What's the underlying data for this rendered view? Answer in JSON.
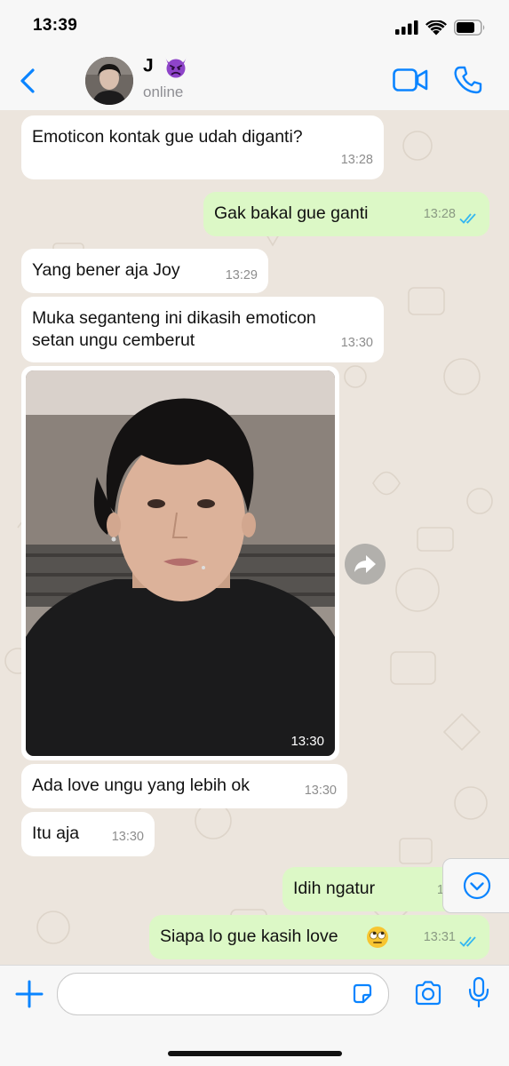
{
  "status_bar": {
    "time": "13:39"
  },
  "header": {
    "contact_name": "J",
    "contact_status": "online",
    "contact_emoji": "purple-devil-emoji",
    "icons": [
      "back-chevron-icon",
      "video-call-icon",
      "phone-call-icon"
    ]
  },
  "messages": [
    {
      "dir": "in",
      "text": "Emoticon kontak gue udah diganti?",
      "time": "13:28"
    },
    {
      "dir": "out",
      "text": "Gak bakal gue ganti",
      "time": "13:28",
      "read": true
    },
    {
      "dir": "in",
      "text": "Yang bener aja Joy",
      "time": "13:29"
    },
    {
      "dir": "in",
      "lines": [
        "Muka seganteng ini dikasih emoticon",
        "setan ungu cemberut"
      ],
      "time": "13:30"
    },
    {
      "dir": "in",
      "type": "photo",
      "time": "13:30"
    },
    {
      "dir": "in",
      "text": "Ada love ungu yang lebih ok",
      "time": "13:30"
    },
    {
      "dir": "in",
      "text": "Itu aja",
      "time": "13:30"
    },
    {
      "dir": "out",
      "text": "Idih ngatur",
      "time": "13:"
    },
    {
      "dir": "out",
      "text": "Siapa lo gue kasih love",
      "emoji": "eye-roll-emoji",
      "time": "13:31",
      "read": true
    }
  ],
  "input": {
    "placeholder": "",
    "icons": [
      "plus-icon",
      "sticker-icon",
      "camera-icon",
      "microphone-icon"
    ]
  },
  "colors": {
    "accent": "#0a84ff",
    "incoming_bubble": "#ffffff",
    "outgoing_bubble": "#dcf8c6",
    "chat_background": "#ece5dd",
    "read_ticks": "#34b7f1"
  }
}
